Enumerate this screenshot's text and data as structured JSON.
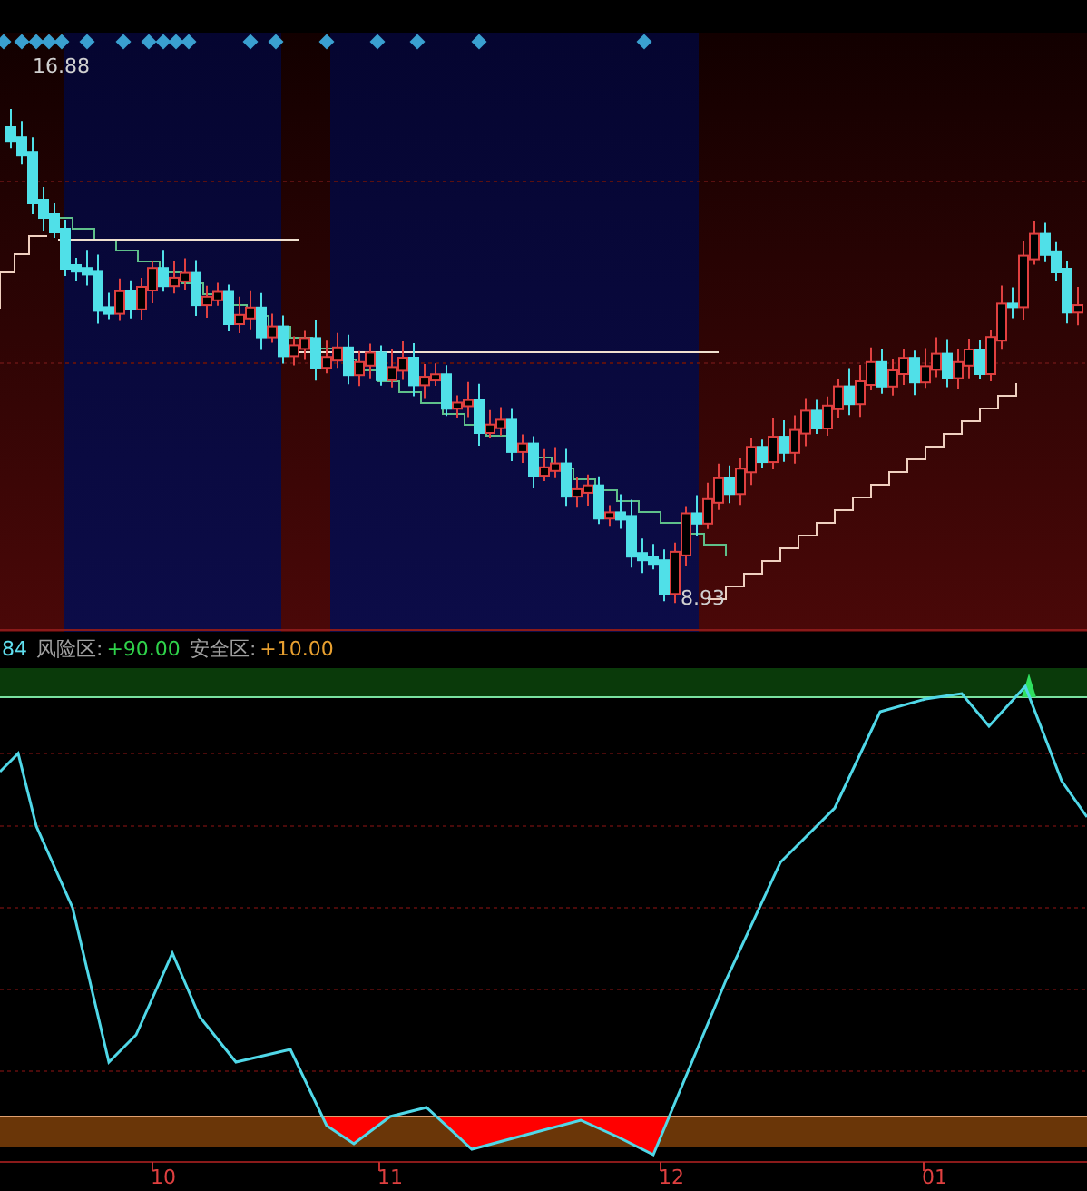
{
  "price_panel": {
    "high_label": "16.88",
    "low_label": "8.93"
  },
  "indicator_panel": {
    "header_cut": "84",
    "zones": [
      {
        "label": "风险区:",
        "value": "+90.00",
        "color": "#2fd24a"
      },
      {
        "label": "安全区:",
        "value": "+10.00",
        "color": "#e8a030"
      }
    ]
  },
  "x_axis": {
    "labels": [
      "10",
      "11",
      "12",
      "01"
    ]
  }
}
